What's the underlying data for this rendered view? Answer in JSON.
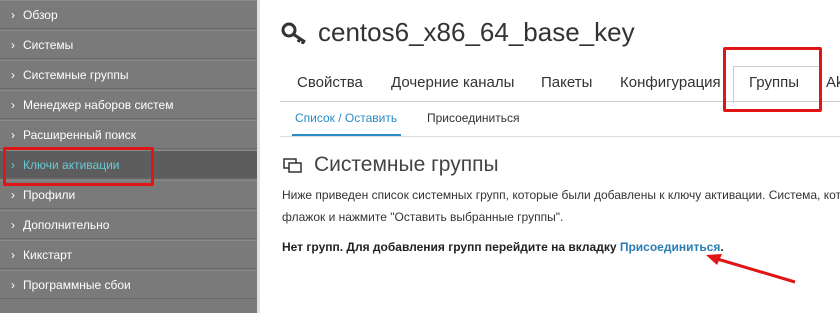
{
  "sidebar": {
    "items": [
      {
        "label": "Обзор"
      },
      {
        "label": "Системы"
      },
      {
        "label": "Системные группы"
      },
      {
        "label": "Менеджер наборов систем"
      },
      {
        "label": "Расширенный поиск"
      },
      {
        "label": "Ключи активации"
      },
      {
        "label": "Профили"
      },
      {
        "label": "Дополнительно"
      },
      {
        "label": "Кикстарт"
      },
      {
        "label": "Программные сбои"
      }
    ],
    "active_index": 5
  },
  "page": {
    "title": "centos6_x86_64_base_key",
    "tabs": [
      "Свойства",
      "Дочерние каналы",
      "Пакеты",
      "Конфигурация",
      "Группы",
      "Ak"
    ],
    "active_tab": "Группы",
    "subtabs": [
      "Список / Оставить",
      "Присоединиться"
    ],
    "active_subtab": "Список / Оставить"
  },
  "section": {
    "title": "Системные группы",
    "description_line1": "Ниже приведен список системных групп, которые были добавлены к ключу активации. Система, кот",
    "description_line2": "флажок и нажмите \"Оставить выбранные группы\".",
    "no_groups_text": "Нет групп. Для добавления групп перейдите на вкладку ",
    "no_groups_link": "Присоединиться",
    "no_groups_suffix": "."
  },
  "colors": {
    "sidebar_bg": "#7a7a7a",
    "active_item_text": "#67c9d6",
    "link": "#2a7db3",
    "annotation_red": "#e01515"
  }
}
